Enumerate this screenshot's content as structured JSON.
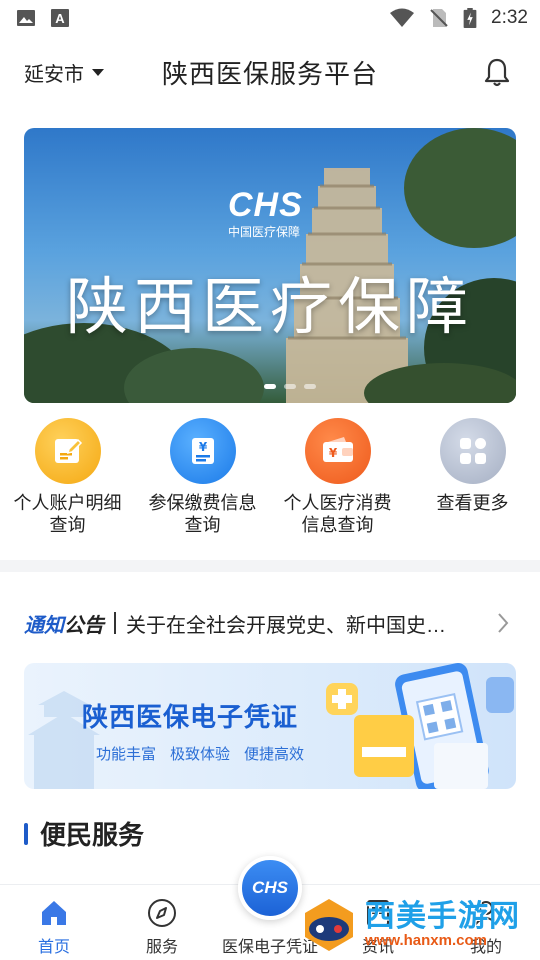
{
  "status_bar": {
    "time": "2:32",
    "left_icons": [
      "image-icon",
      "font-a-icon"
    ],
    "right_icons": [
      "wifi-icon",
      "no-sim-icon",
      "battery-charging-icon"
    ]
  },
  "header": {
    "city": "延安市",
    "title": "陕西医保服务平台",
    "bell_icon": "bell-icon"
  },
  "banner": {
    "logo_text": "CHS",
    "logo_sub": "中国医疗保障",
    "headline": "陕西医疗保障",
    "slide_count": 3,
    "active_slide": 1
  },
  "quick_actions": [
    {
      "label": "个人账户明细查询",
      "icon": "edit-doc-icon",
      "color": "#f7b52c"
    },
    {
      "label": "参保缴费信息查询",
      "icon": "yen-doc-icon",
      "color": "#2d8ff0"
    },
    {
      "label": "个人医疗消费信息查询",
      "icon": "wallet-yen-icon",
      "color": "#f26a2e"
    },
    {
      "label": "查看更多",
      "icon": "grid-more-icon",
      "color": "#a9b3c6"
    }
  ],
  "notice": {
    "brand_1": "通知",
    "brand_2": "公告",
    "text": "关于在全社会开展党史、新中国史…"
  },
  "promo": {
    "title": "陕西医保电子凭证",
    "tags": [
      "功能丰富",
      "极致体验",
      "便捷高效"
    ]
  },
  "section": {
    "title": "便民服务"
  },
  "bottom_nav": {
    "items": [
      {
        "label": "首页",
        "icon": "home-icon",
        "active": true
      },
      {
        "label": "服务",
        "icon": "compass-icon",
        "active": false
      },
      {
        "label": "医保电子凭证",
        "icon": "chs-logo-icon",
        "active": false
      },
      {
        "label": "资讯",
        "icon": "news-icon",
        "active": false
      },
      {
        "label": "我的",
        "icon": "user-icon",
        "active": false
      }
    ],
    "center_text": "CHS"
  },
  "watermark": {
    "text": "西美手游网",
    "url": "www.hanxm.com"
  },
  "colors": {
    "accent": "#2a6fe0",
    "brand_blue": "#1e5bc8"
  }
}
